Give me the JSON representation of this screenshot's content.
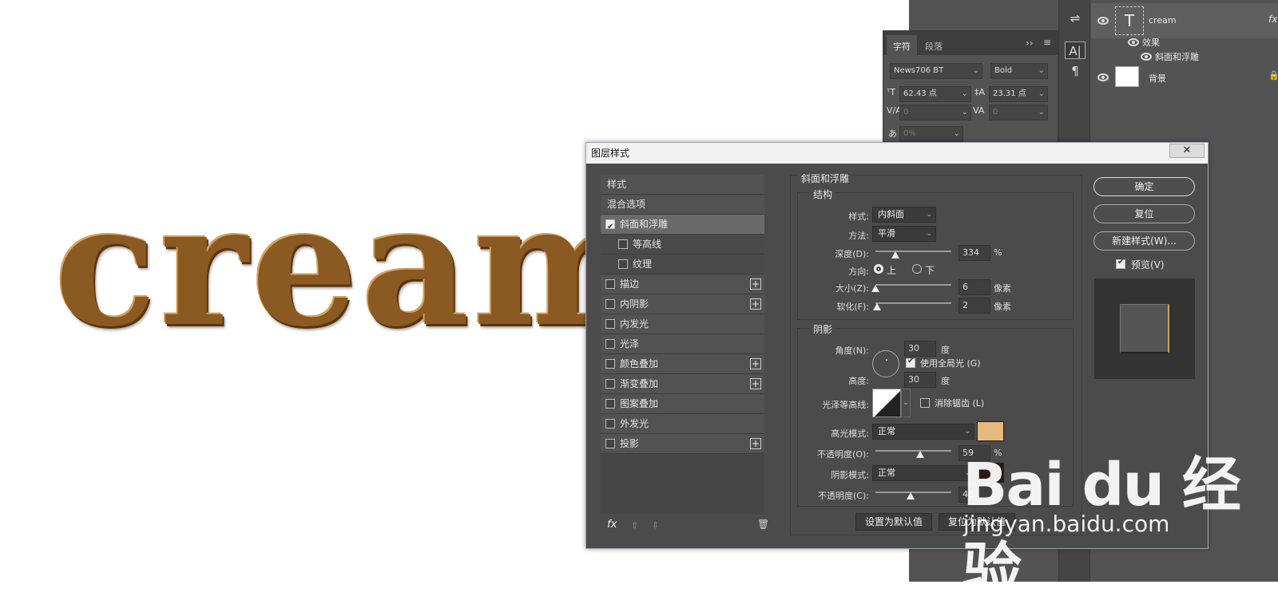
{
  "canvas": {
    "text": "cream",
    "text_color": "#8a5a22"
  },
  "layers": {
    "rows": [
      {
        "name": "cream",
        "type_icon": "T",
        "fx": "fx"
      },
      {
        "name": "效果"
      },
      {
        "name": "斜面和浮雕"
      },
      {
        "name": "背景"
      }
    ]
  },
  "char_panel": {
    "tabs": [
      "字符",
      "段落"
    ],
    "font_family": "News706 BT",
    "font_style": "Bold",
    "font_size": "62.43 点",
    "leading": "23.31 点",
    "kerning": "0",
    "tracking": "0",
    "scale": "0%",
    "menu_glyph": "≡",
    "expand_glyph": "››"
  },
  "dialog": {
    "title": "图层样式",
    "close_label": "✕",
    "style_list": [
      {
        "label": "样式",
        "checkbox": false,
        "checked": false,
        "plus": false,
        "type": "header"
      },
      {
        "label": "混合选项",
        "checkbox": false,
        "checked": false,
        "plus": false,
        "type": "header"
      },
      {
        "label": "斜面和浮雕",
        "checkbox": true,
        "checked": true,
        "plus": false,
        "type": "selected"
      },
      {
        "label": "等高线",
        "checkbox": true,
        "checked": false,
        "plus": false,
        "type": "sub"
      },
      {
        "label": "纹理",
        "checkbox": true,
        "checked": false,
        "plus": false,
        "type": "sub"
      },
      {
        "label": "描边",
        "checkbox": true,
        "checked": false,
        "plus": true,
        "type": "item"
      },
      {
        "label": "内阴影",
        "checkbox": true,
        "checked": false,
        "plus": true,
        "type": "item"
      },
      {
        "label": "内发光",
        "checkbox": true,
        "checked": false,
        "plus": false,
        "type": "item"
      },
      {
        "label": "光泽",
        "checkbox": true,
        "checked": false,
        "plus": false,
        "type": "item"
      },
      {
        "label": "颜色叠加",
        "checkbox": true,
        "checked": false,
        "plus": true,
        "type": "item"
      },
      {
        "label": "渐变叠加",
        "checkbox": true,
        "checked": false,
        "plus": true,
        "type": "item"
      },
      {
        "label": "图案叠加",
        "checkbox": true,
        "checked": false,
        "plus": false,
        "type": "item"
      },
      {
        "label": "外发光",
        "checkbox": true,
        "checked": false,
        "plus": false,
        "type": "item"
      },
      {
        "label": "投影",
        "checkbox": true,
        "checked": false,
        "plus": true,
        "type": "item"
      }
    ],
    "footer": {
      "fx": "fx",
      "up": "⇧",
      "down": "⇩",
      "trash": "🗑"
    },
    "bevel": {
      "section_title": "斜面和浮雕",
      "structure_title": "结构",
      "style_label": "样式:",
      "style_value": "内斜面",
      "technique_label": "方法:",
      "technique_value": "平滑",
      "depth_label": "深度(D):",
      "depth_value": "334",
      "depth_unit": "%",
      "direction_label": "方向:",
      "dir_up": "上",
      "dir_down": "下",
      "size_label": "大小(Z):",
      "size_value": "6",
      "size_unit": "像素",
      "soften_label": "软化(F):",
      "soften_value": "2",
      "soften_unit": "像素",
      "depth_level": 0.26,
      "size_level": 0.0,
      "soften_level": 0.02
    },
    "shading": {
      "title": "阴影",
      "angle_label": "角度(N):",
      "angle_value": "30",
      "angle_unit": "度",
      "global_light_label": "使用全局光 (G)",
      "altitude_label": "高度:",
      "altitude_value": "30",
      "altitude_unit": "度",
      "gloss_label": "光泽等高线:",
      "anti_alias_label": "消除锯齿 (L)",
      "highlight_mode_label": "高光模式:",
      "highlight_mode_value": "正常",
      "highlight_color": "#e6b97e",
      "highlight_opacity_label": "不透明度(O):",
      "highlight_opacity_value": "59",
      "highlight_opacity_unit": "%",
      "highlight_opacity_level": 0.59,
      "shadow_mode_label": "阴影模式:",
      "shadow_mode_value": "正常",
      "shadow_color": "#2a1a12",
      "shadow_opacity_label": "不透明度(C):",
      "shadow_opacity_value": "46",
      "shadow_opacity_level": 0.46
    },
    "buttons": {
      "set_default": "设置为默认值",
      "reset_default": "复位为默认值",
      "ok": "确定",
      "reset": "复位",
      "new_style": "新建样式(W)...",
      "preview_label": "预览(V)"
    }
  },
  "watermark": {
    "logo": "Bai du 经验",
    "url": "jingyan.baidu.com"
  }
}
